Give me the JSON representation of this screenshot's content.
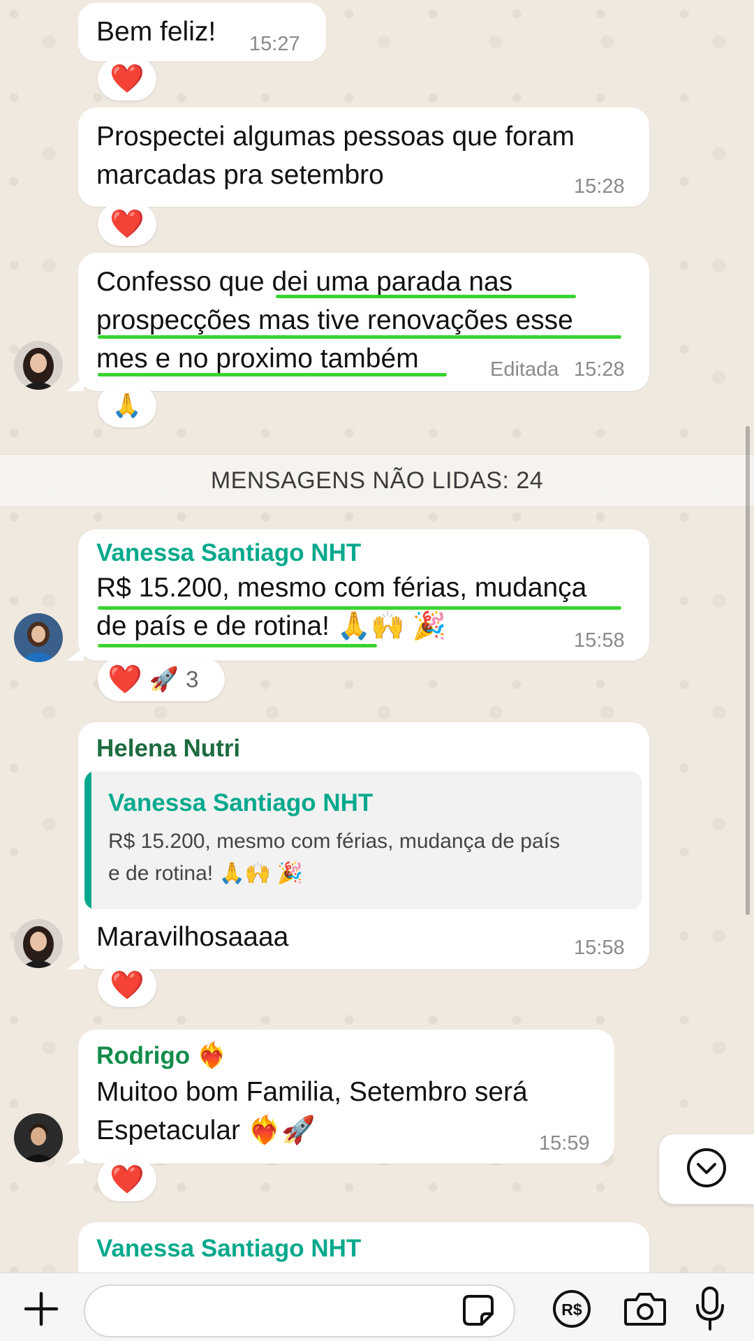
{
  "messages": [
    {
      "text": "Bem feliz!",
      "time": "15:27",
      "reactions": [
        {
          "emoji": "❤️"
        }
      ]
    },
    {
      "text": "Prospectei algumas pessoas que foram\nmarcadas pra setembro",
      "time": "15:28",
      "reactions": [
        {
          "emoji": "❤️"
        }
      ]
    },
    {
      "text": "Confesso que dei uma parada nas\nprospecções mas tive renovações esse\nmes e no proximo também",
      "edited_label": "Editada",
      "time": "15:28",
      "reactions": [
        {
          "emoji": "🙏"
        }
      ]
    },
    {
      "sender": "Vanessa Santiago NHT",
      "text": "R$ 15.200, mesmo com férias, mudança\nde país e de rotina! 🙏🙌 🎉",
      "time": "15:58",
      "reactions": [
        {
          "emoji": "❤️"
        },
        {
          "emoji": "🚀"
        }
      ],
      "reaction_count": "3"
    },
    {
      "sender": "Helena Nutri",
      "quote": {
        "sender": "Vanessa Santiago NHT",
        "text": "R$ 15.200, mesmo com férias, mudança de país\ne de rotina! 🙏🙌 🎉"
      },
      "text": "Maravilhosaaaa",
      "time": "15:58",
      "reactions": [
        {
          "emoji": "❤️"
        }
      ]
    },
    {
      "sender": "Rodrigo ❤️‍🔥",
      "text": "Muitoo bom Familia, Setembro será\nEspetacular ❤️‍🔥🚀",
      "time": "15:59",
      "reactions": [
        {
          "emoji": "❤️"
        }
      ]
    },
    {
      "sender": "Vanessa Santiago NHT"
    }
  ],
  "unread_divider": "MENSAGENS NÃO LIDAS: 24",
  "composer": {
    "placeholder": "",
    "value": ""
  },
  "icons": {
    "add": "plus-icon",
    "sticker": "sticker-icon",
    "payment": "pix-currency-icon",
    "camera": "camera-icon",
    "mic": "microphone-icon",
    "scroll_down": "chevron-down-circle-icon"
  },
  "colors": {
    "vanessa": "#07a98c",
    "helena": "#1d6b3f",
    "rodrigo": "#128c4a",
    "highlight": "#39d32f",
    "heart": "#e01b24"
  }
}
